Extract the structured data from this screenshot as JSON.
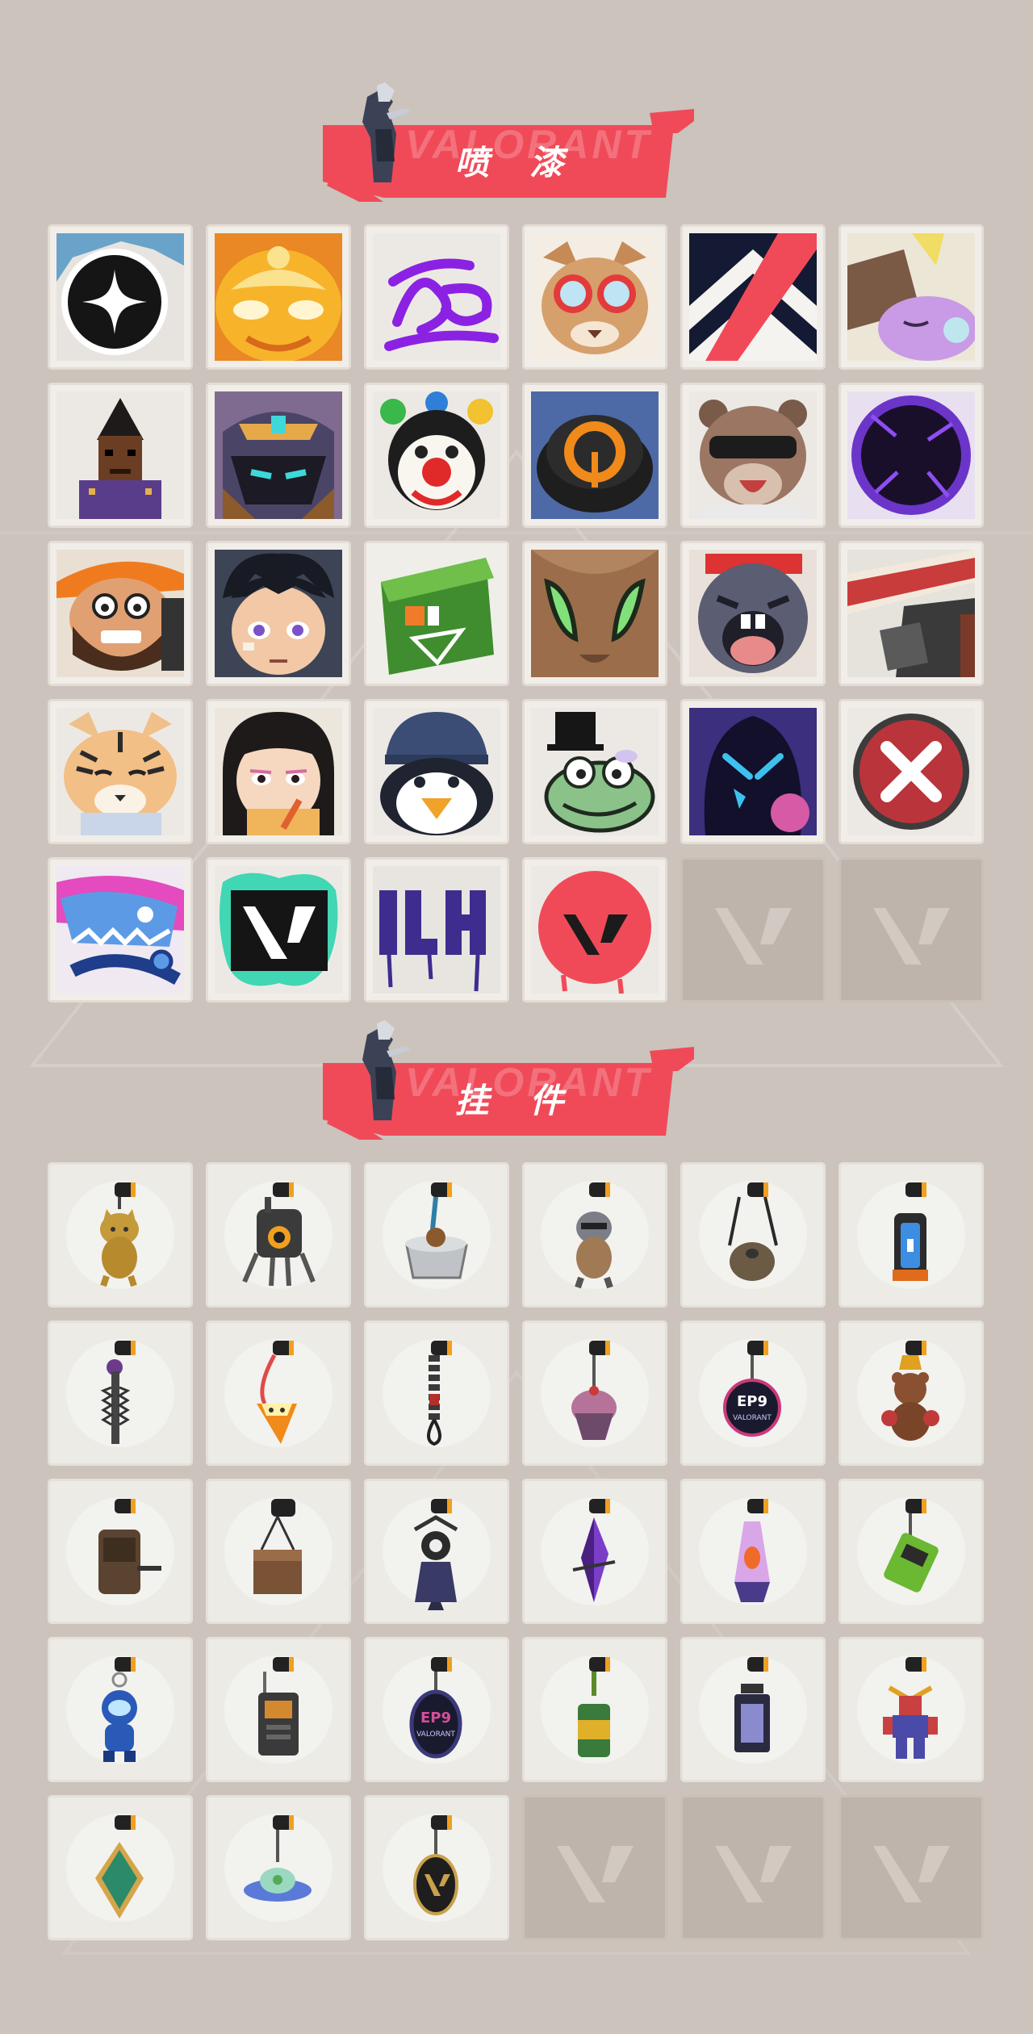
{
  "sections": {
    "sprays": {
      "title": "喷 漆",
      "watermark": "VALORANT",
      "items": [
        {
          "icon": "star-badge-spray-icon"
        },
        {
          "icon": "golden-mask-spray-icon"
        },
        {
          "icon": "purple-scribble-spray-icon"
        },
        {
          "icon": "goggles-cat-spray-icon"
        },
        {
          "icon": "chevron-flag-spray-icon"
        },
        {
          "icon": "sleepy-creature-spray-icon"
        },
        {
          "icon": "pixel-agent-spray-icon"
        },
        {
          "icon": "armored-helmet-spray-icon"
        },
        {
          "icon": "clown-face-spray-icon"
        },
        {
          "icon": "orange-dial-spray-icon"
        },
        {
          "icon": "sunglasses-bear-spray-icon"
        },
        {
          "icon": "void-orb-spray-icon"
        },
        {
          "icon": "bearded-grin-spray-icon"
        },
        {
          "icon": "anime-boy-spray-icon"
        },
        {
          "icon": "green-crate-spray-icon"
        },
        {
          "icon": "green-eyes-spray-icon"
        },
        {
          "icon": "crying-seal-spray-icon"
        },
        {
          "icon": "cake-slice-spray-icon"
        },
        {
          "icon": "tiger-spray-icon"
        },
        {
          "icon": "studying-girl-spray-icon"
        },
        {
          "icon": "penguin-beanie-spray-icon"
        },
        {
          "icon": "frog-top-hat-spray-icon"
        },
        {
          "icon": "shadow-creature-spray-icon"
        },
        {
          "icon": "close-x-spray-icon"
        },
        {
          "icon": "ice-shark-spray-icon"
        },
        {
          "icon": "valorant-splatter-spray-icon"
        },
        {
          "icon": "graffiti-tag-spray-icon"
        },
        {
          "icon": "red-valorant-drip-spray-icon"
        },
        {
          "icon": "empty-slot"
        },
        {
          "icon": "empty-slot"
        }
      ]
    },
    "charms": {
      "title": "挂 件",
      "watermark": "VALORANT",
      "items": [
        {
          "icon": "golden-cat-charm-icon"
        },
        {
          "icon": "robot-drone-charm-icon"
        },
        {
          "icon": "bathtub-charm-icon"
        },
        {
          "icon": "raccoon-charm-icon"
        },
        {
          "icon": "canteen-charm-icon"
        },
        {
          "icon": "canister-charm-icon"
        },
        {
          "icon": "serrated-blade-charm-icon"
        },
        {
          "icon": "candy-corn-charm-icon"
        },
        {
          "icon": "paracord-charm-icon"
        },
        {
          "icon": "cupcake-charm-icon"
        },
        {
          "icon": "ep9-medal-charm-icon"
        },
        {
          "icon": "bear-bell-charm-icon"
        },
        {
          "icon": "backpack-charm-icon"
        },
        {
          "icon": "box-crate-charm-icon"
        },
        {
          "icon": "jester-doll-charm-icon"
        },
        {
          "icon": "amethyst-charm-icon"
        },
        {
          "icon": "lava-lamp-charm-icon"
        },
        {
          "icon": "green-pager-charm-icon"
        },
        {
          "icon": "astronaut-charm-icon"
        },
        {
          "icon": "walkie-talkie-charm-icon"
        },
        {
          "icon": "ep9-badge-charm-icon"
        },
        {
          "icon": "green-can-charm-icon"
        },
        {
          "icon": "lantern-charm-icon"
        },
        {
          "icon": "mecha-robot-charm-icon"
        },
        {
          "icon": "emerald-diamond-charm-icon"
        },
        {
          "icon": "ufo-charm-icon"
        },
        {
          "icon": "valorant-tag-charm-icon"
        },
        {
          "icon": "empty-slot"
        },
        {
          "icon": "empty-slot"
        },
        {
          "icon": "empty-slot"
        }
      ]
    }
  },
  "colors": {
    "accent": "#f04a59",
    "background": "#cbc3bc",
    "tile": "#f1eee9",
    "empty": "#beb4ab"
  }
}
